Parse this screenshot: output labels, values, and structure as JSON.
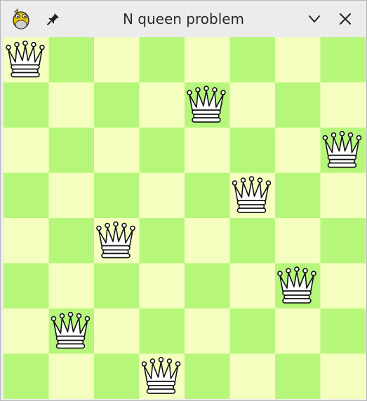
{
  "window": {
    "title": "N queen problem",
    "app_icon": "pygame-snake-icon",
    "buttons": [
      "pin-icon",
      "chevron-down-icon",
      "close-icon"
    ]
  },
  "board": {
    "size": 8,
    "colors": {
      "light": "#f4ffbf",
      "dark": "#b6f77b",
      "queen_fill": "#ffffff",
      "queen_stroke": "#111111"
    },
    "queen_columns_by_row": [
      0,
      4,
      7,
      5,
      2,
      6,
      1,
      3
    ]
  }
}
